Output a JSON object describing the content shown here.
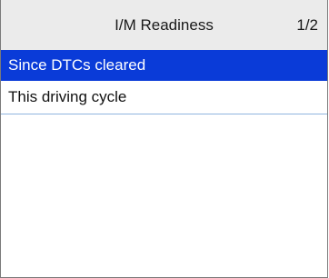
{
  "header": {
    "title": "I/M Readiness",
    "page_indicator": "1/2"
  },
  "menu": {
    "items": [
      {
        "label": "Since DTCs cleared",
        "selected": true
      },
      {
        "label": "This driving cycle",
        "selected": false
      }
    ]
  },
  "colors": {
    "header_background": "#ebebeb",
    "selected_background": "#0a3bd8",
    "selected_text": "#ffffff",
    "divider": "#8fb4df"
  }
}
